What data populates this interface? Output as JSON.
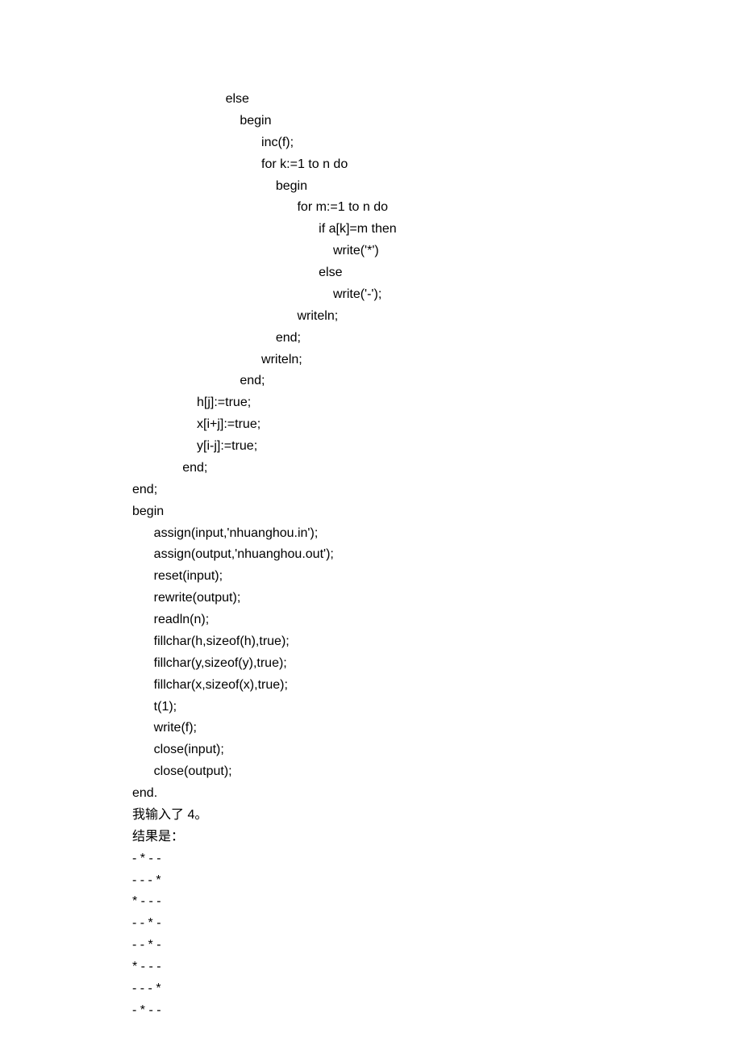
{
  "lines": [
    {
      "indent": 13,
      "text": "else"
    },
    {
      "indent": 15,
      "text": "begin"
    },
    {
      "indent": 18,
      "text": "inc(f);"
    },
    {
      "indent": 18,
      "text": "for k:=1 to n do"
    },
    {
      "indent": 20,
      "text": "begin"
    },
    {
      "indent": 23,
      "text": "for m:=1 to n do"
    },
    {
      "indent": 26,
      "text": "if a[k]=m then"
    },
    {
      "indent": 28,
      "text": "write('*')"
    },
    {
      "indent": 26,
      "text": "else"
    },
    {
      "indent": 28,
      "text": "write('-');"
    },
    {
      "indent": 23,
      "text": "writeln;"
    },
    {
      "indent": 20,
      "text": "end;"
    },
    {
      "indent": 18,
      "text": "writeln;"
    },
    {
      "indent": 15,
      "text": "end;"
    },
    {
      "indent": 9,
      "text": "h[j]:=true;"
    },
    {
      "indent": 9,
      "text": "x[i+j]:=true;"
    },
    {
      "indent": 9,
      "text": "y[i-j]:=true;"
    },
    {
      "indent": 7,
      "text": "end;"
    },
    {
      "indent": 0,
      "text": "end;"
    },
    {
      "indent": 0,
      "text": "begin"
    },
    {
      "indent": 3,
      "text": "assign(input,'nhuanghou.in');"
    },
    {
      "indent": 3,
      "text": "assign(output,'nhuanghou.out');"
    },
    {
      "indent": 3,
      "text": "reset(input);"
    },
    {
      "indent": 3,
      "text": "rewrite(output);"
    },
    {
      "indent": 3,
      "text": "readln(n);"
    },
    {
      "indent": 3,
      "text": "fillchar(h,sizeof(h),true);"
    },
    {
      "indent": 3,
      "text": "fillchar(y,sizeof(y),true);"
    },
    {
      "indent": 3,
      "text": "fillchar(x,sizeof(x),true);"
    },
    {
      "indent": 3,
      "text": "t(1);"
    },
    {
      "indent": 3,
      "text": "write(f);"
    },
    {
      "indent": 3,
      "text": "close(input);"
    },
    {
      "indent": 3,
      "text": "close(output);"
    },
    {
      "indent": 0,
      "text": "end."
    },
    {
      "indent": 0,
      "text": "我输入了 4。"
    },
    {
      "indent": 0,
      "text": "结果是："
    },
    {
      "indent": 0,
      "text": "- * - -"
    },
    {
      "indent": 0,
      "text": "- - - *"
    },
    {
      "indent": 0,
      "text": "* - - -"
    },
    {
      "indent": 0,
      "text": "- - * -"
    },
    {
      "indent": 0,
      "text": ""
    },
    {
      "indent": 0,
      "text": "- - * -"
    },
    {
      "indent": 0,
      "text": "* - - -"
    },
    {
      "indent": 0,
      "text": "- - - *"
    },
    {
      "indent": 0,
      "text": "- * - -"
    }
  ]
}
